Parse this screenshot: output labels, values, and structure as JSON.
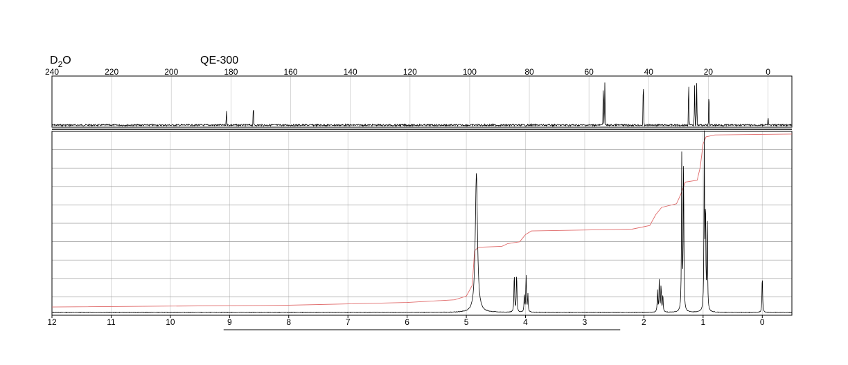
{
  "header": {
    "solvent_main": "D",
    "solvent_sub": "2",
    "solvent_tail": "O",
    "instrument": "QE-300"
  },
  "chart_data": [
    {
      "type": "line",
      "nucleus_axis": "13C",
      "xlim": [
        240,
        -8
      ],
      "x_reversed": true,
      "x_ticks": [
        240,
        220,
        200,
        180,
        160,
        140,
        120,
        100,
        80,
        60,
        40,
        20,
        0
      ],
      "x_tick_labels": [
        "240",
        "220",
        "200",
        "180",
        "160",
        "140",
        "120",
        "100",
        "80",
        "60",
        "40",
        "20",
        "0"
      ],
      "grid": true,
      "peaks": [
        {
          "ppm": 181.5,
          "height": 0.32
        },
        {
          "ppm": 172.5,
          "height": 0.42
        },
        {
          "ppm": 55.2,
          "height": 0.9
        },
        {
          "ppm": 54.7,
          "height": 0.88
        },
        {
          "ppm": 41.8,
          "height": 0.95
        },
        {
          "ppm": 26.6,
          "height": 0.95
        },
        {
          "ppm": 24.6,
          "height": 0.85
        },
        {
          "ppm": 23.9,
          "height": 0.9
        },
        {
          "ppm": 19.8,
          "height": 0.72
        },
        {
          "ppm": 0.0,
          "height": 0.18
        }
      ]
    },
    {
      "type": "line",
      "nucleus_axis": "1H",
      "xlim": [
        12,
        -0.5
      ],
      "x_reversed": true,
      "x_ticks": [
        12,
        11,
        10,
        9,
        8,
        7,
        6,
        5,
        4,
        3,
        2,
        1,
        0
      ],
      "x_tick_labels": [
        "12",
        "11",
        "10",
        "9",
        "8",
        "7",
        "6",
        "5",
        "4",
        "3",
        "2",
        "1",
        "0"
      ],
      "grid": true,
      "peaks": [
        {
          "ppm": 4.83,
          "height": 0.77
        },
        {
          "ppm": 4.19,
          "height": 0.22
        },
        {
          "ppm": 4.15,
          "height": 0.22
        },
        {
          "ppm": 4.02,
          "height": 0.1
        },
        {
          "ppm": 3.99,
          "height": 0.21
        },
        {
          "ppm": 3.96,
          "height": 0.1
        },
        {
          "ppm": 1.77,
          "height": 0.12
        },
        {
          "ppm": 1.74,
          "height": 0.18
        },
        {
          "ppm": 1.71,
          "height": 0.15
        },
        {
          "ppm": 1.68,
          "height": 0.1
        },
        {
          "ppm": 1.36,
          "height": 0.88
        },
        {
          "ppm": 1.33,
          "height": 0.83
        },
        {
          "ppm": 0.98,
          "height": 0.96
        },
        {
          "ppm": 0.96,
          "height": 0.56
        },
        {
          "ppm": 0.93,
          "height": 0.53
        },
        {
          "ppm": 0.0,
          "height": 0.21
        }
      ],
      "integral": {
        "color": "#e06a6a",
        "points": [
          [
            12,
            0.03
          ],
          [
            8,
            0.04
          ],
          [
            6,
            0.055
          ],
          [
            5.2,
            0.07
          ],
          [
            5.0,
            0.09
          ],
          [
            4.9,
            0.15
          ],
          [
            4.86,
            0.34
          ],
          [
            4.8,
            0.36
          ],
          [
            4.4,
            0.365
          ],
          [
            4.3,
            0.38
          ],
          [
            4.2,
            0.385
          ],
          [
            4.1,
            0.39
          ],
          [
            4.0,
            0.43
          ],
          [
            3.9,
            0.45
          ],
          [
            2.2,
            0.46
          ],
          [
            1.9,
            0.48
          ],
          [
            1.8,
            0.54
          ],
          [
            1.7,
            0.58
          ],
          [
            1.45,
            0.6
          ],
          [
            1.38,
            0.65
          ],
          [
            1.3,
            0.72
          ],
          [
            1.1,
            0.73
          ],
          [
            1.05,
            0.8
          ],
          [
            1.0,
            0.93
          ],
          [
            0.95,
            0.97
          ],
          [
            0.8,
            0.98
          ],
          [
            -0.5,
            0.985
          ]
        ]
      },
      "highlight_range": [
        9.1,
        2.4
      ]
    }
  ]
}
